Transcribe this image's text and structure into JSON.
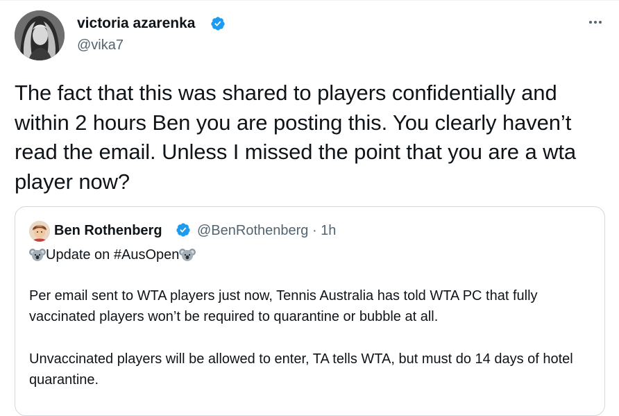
{
  "tweet": {
    "author_name": "victoria azarenka",
    "handle": "@vika7",
    "text": "The fact that this was shared to players confidentially and within 2 hours Ben you are posting this. You clearly haven’t read the email. Unless I missed the point that you are a wta player now?",
    "icons": {
      "verified": "verified-badge-icon",
      "more": "more-options-icon"
    },
    "colors": {
      "verified": "#1d9bf0",
      "secondary_text": "#536471"
    }
  },
  "quoted_tweet": {
    "author_name": "Ben Rothenberg",
    "meta": "@BenRothenberg · 1h",
    "headline": "Update on #AusOpen",
    "paragraph1": "Per email sent to WTA players just now, Tennis Australia has told WTA PC  that fully vaccinated players won’t be required to quarantine or bubble at all.",
    "paragraph2": "Unvaccinated players will be allowed to enter, TA tells WTA, but must do 14 days of hotel quarantine.",
    "icons": {
      "emoji": "koala-emoji-icon"
    }
  }
}
